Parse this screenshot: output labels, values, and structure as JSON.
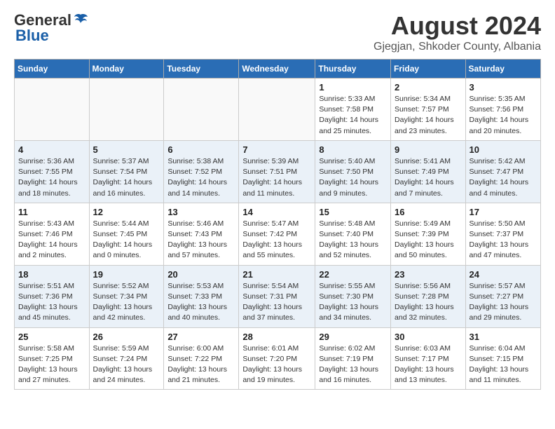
{
  "logo": {
    "general": "General",
    "blue": "Blue"
  },
  "title": "August 2024",
  "subtitle": "Gjegjan, Shkoder County, Albania",
  "days_header": [
    "Sunday",
    "Monday",
    "Tuesday",
    "Wednesday",
    "Thursday",
    "Friday",
    "Saturday"
  ],
  "weeks": [
    [
      {
        "day": "",
        "info": ""
      },
      {
        "day": "",
        "info": ""
      },
      {
        "day": "",
        "info": ""
      },
      {
        "day": "",
        "info": ""
      },
      {
        "day": "1",
        "info": "Sunrise: 5:33 AM\nSunset: 7:58 PM\nDaylight: 14 hours\nand 25 minutes."
      },
      {
        "day": "2",
        "info": "Sunrise: 5:34 AM\nSunset: 7:57 PM\nDaylight: 14 hours\nand 23 minutes."
      },
      {
        "day": "3",
        "info": "Sunrise: 5:35 AM\nSunset: 7:56 PM\nDaylight: 14 hours\nand 20 minutes."
      }
    ],
    [
      {
        "day": "4",
        "info": "Sunrise: 5:36 AM\nSunset: 7:55 PM\nDaylight: 14 hours\nand 18 minutes."
      },
      {
        "day": "5",
        "info": "Sunrise: 5:37 AM\nSunset: 7:54 PM\nDaylight: 14 hours\nand 16 minutes."
      },
      {
        "day": "6",
        "info": "Sunrise: 5:38 AM\nSunset: 7:52 PM\nDaylight: 14 hours\nand 14 minutes."
      },
      {
        "day": "7",
        "info": "Sunrise: 5:39 AM\nSunset: 7:51 PM\nDaylight: 14 hours\nand 11 minutes."
      },
      {
        "day": "8",
        "info": "Sunrise: 5:40 AM\nSunset: 7:50 PM\nDaylight: 14 hours\nand 9 minutes."
      },
      {
        "day": "9",
        "info": "Sunrise: 5:41 AM\nSunset: 7:49 PM\nDaylight: 14 hours\nand 7 minutes."
      },
      {
        "day": "10",
        "info": "Sunrise: 5:42 AM\nSunset: 7:47 PM\nDaylight: 14 hours\nand 4 minutes."
      }
    ],
    [
      {
        "day": "11",
        "info": "Sunrise: 5:43 AM\nSunset: 7:46 PM\nDaylight: 14 hours\nand 2 minutes."
      },
      {
        "day": "12",
        "info": "Sunrise: 5:44 AM\nSunset: 7:45 PM\nDaylight: 14 hours\nand 0 minutes."
      },
      {
        "day": "13",
        "info": "Sunrise: 5:46 AM\nSunset: 7:43 PM\nDaylight: 13 hours\nand 57 minutes."
      },
      {
        "day": "14",
        "info": "Sunrise: 5:47 AM\nSunset: 7:42 PM\nDaylight: 13 hours\nand 55 minutes."
      },
      {
        "day": "15",
        "info": "Sunrise: 5:48 AM\nSunset: 7:40 PM\nDaylight: 13 hours\nand 52 minutes."
      },
      {
        "day": "16",
        "info": "Sunrise: 5:49 AM\nSunset: 7:39 PM\nDaylight: 13 hours\nand 50 minutes."
      },
      {
        "day": "17",
        "info": "Sunrise: 5:50 AM\nSunset: 7:37 PM\nDaylight: 13 hours\nand 47 minutes."
      }
    ],
    [
      {
        "day": "18",
        "info": "Sunrise: 5:51 AM\nSunset: 7:36 PM\nDaylight: 13 hours\nand 45 minutes."
      },
      {
        "day": "19",
        "info": "Sunrise: 5:52 AM\nSunset: 7:34 PM\nDaylight: 13 hours\nand 42 minutes."
      },
      {
        "day": "20",
        "info": "Sunrise: 5:53 AM\nSunset: 7:33 PM\nDaylight: 13 hours\nand 40 minutes."
      },
      {
        "day": "21",
        "info": "Sunrise: 5:54 AM\nSunset: 7:31 PM\nDaylight: 13 hours\nand 37 minutes."
      },
      {
        "day": "22",
        "info": "Sunrise: 5:55 AM\nSunset: 7:30 PM\nDaylight: 13 hours\nand 34 minutes."
      },
      {
        "day": "23",
        "info": "Sunrise: 5:56 AM\nSunset: 7:28 PM\nDaylight: 13 hours\nand 32 minutes."
      },
      {
        "day": "24",
        "info": "Sunrise: 5:57 AM\nSunset: 7:27 PM\nDaylight: 13 hours\nand 29 minutes."
      }
    ],
    [
      {
        "day": "25",
        "info": "Sunrise: 5:58 AM\nSunset: 7:25 PM\nDaylight: 13 hours\nand 27 minutes."
      },
      {
        "day": "26",
        "info": "Sunrise: 5:59 AM\nSunset: 7:24 PM\nDaylight: 13 hours\nand 24 minutes."
      },
      {
        "day": "27",
        "info": "Sunrise: 6:00 AM\nSunset: 7:22 PM\nDaylight: 13 hours\nand 21 minutes."
      },
      {
        "day": "28",
        "info": "Sunrise: 6:01 AM\nSunset: 7:20 PM\nDaylight: 13 hours\nand 19 minutes."
      },
      {
        "day": "29",
        "info": "Sunrise: 6:02 AM\nSunset: 7:19 PM\nDaylight: 13 hours\nand 16 minutes."
      },
      {
        "day": "30",
        "info": "Sunrise: 6:03 AM\nSunset: 7:17 PM\nDaylight: 13 hours\nand 13 minutes."
      },
      {
        "day": "31",
        "info": "Sunrise: 6:04 AM\nSunset: 7:15 PM\nDaylight: 13 hours\nand 11 minutes."
      }
    ]
  ]
}
